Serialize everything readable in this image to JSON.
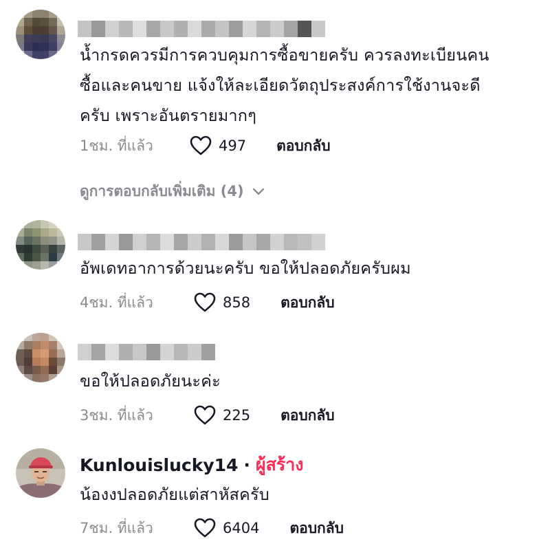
{
  "comments": [
    {
      "text_lines": [
        "น้ำกรดควรมีการควบคุมการซื้อขายครับ ควรลงทะเบียนคน",
        "ซื้อและคนขาย แจ้งให้ละเอียดวัตถุประสงค์การใช้งานจะดี",
        "ครับ เพราะอันตรายมากๆ"
      ],
      "time": "1ชม. ที่แล้ว",
      "likes": "497",
      "reply_label": "ตอบกลับ"
    },
    {
      "text_lines": [
        "อัพเดทอาการด้วยนะครับ ขอให้ปลอดภัยครับผม"
      ],
      "time": "4ชม. ที่แล้ว",
      "likes": "858",
      "reply_label": "ตอบกลับ"
    },
    {
      "text_lines": [
        "ขอให้ปลอดภัยนะค่ะ"
      ],
      "time": "3ชม. ที่แล้ว",
      "likes": "225",
      "reply_label": "ตอบกลับ"
    },
    {
      "username": "Kunlouislucky14",
      "separator": "·",
      "creator_badge": "ผู้สร้าง",
      "text_lines": [
        "น้องงปลอดภัยแต่สาหัสครับ"
      ],
      "time": "7ชม. ที่แล้ว",
      "likes": "6404",
      "reply_label": "ตอบกลับ"
    }
  ],
  "view_more_replies": "ดูการตอบกลับเพิ่มเติม (4)",
  "icons": {
    "like": "heart-outline-icon",
    "expand": "chevron-down-icon"
  },
  "colors": {
    "creator": "#fe2c55",
    "muted": "#8a8b91",
    "text": "#161823"
  }
}
